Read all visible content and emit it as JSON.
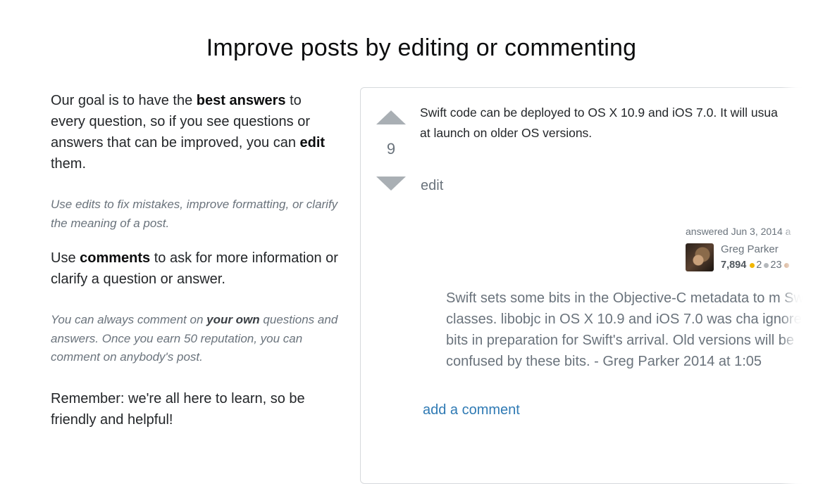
{
  "page": {
    "title": "Improve posts by editing or commenting"
  },
  "guide": {
    "p1": {
      "t1": "Our goal is to have the ",
      "b1": "best answers",
      "t2": " to every question, so if you see questions or answers that can be improved, you can ",
      "b2": "edit",
      "t3": " them."
    },
    "p2": "Use edits to fix mistakes, improve formatting, or clarify the meaning of a post.",
    "p3": {
      "t1": "Use ",
      "b1": "comments",
      "t2": " to ask for more information or clarify a question or answer."
    },
    "p4": {
      "t1": "You can always comment on ",
      "b1": "your own",
      "t2": " questions and answers. Once you earn 50 reputation, you can comment on anybody's post."
    },
    "p5": "Remember: we're all here to learn, so be friendly and helpful!"
  },
  "post": {
    "vote_count": "9",
    "body_line1": "Swift code can be deployed to OS X 10.9 and iOS 7.0. It will usua",
    "body_line2": "at launch on older OS versions.",
    "edit_label": "edit",
    "answered_text": "answered Jun 3, 2014 a",
    "user": {
      "name": "Greg Parker",
      "reputation": "7,894",
      "gold": "2",
      "silver": "23"
    },
    "comment_text": "Swift sets some bits in the Objective-C metadata to m Swift classes. libobjc in OS X 10.9 and iOS 7.0 was cha ignore these bits in preparation for Swift's arrival. Old versions will be confused by these bits. - Greg Parker 2014 at 1:05",
    "add_comment_label": "add a comment"
  },
  "colors": {
    "link": "#2f7ab4",
    "vote_arrow": "#a9afb4",
    "muted_text": "#6a737c",
    "gold_badge": "#f1b600",
    "silver_badge": "#b4b8bc",
    "bronze_badge": "#d1a684"
  }
}
